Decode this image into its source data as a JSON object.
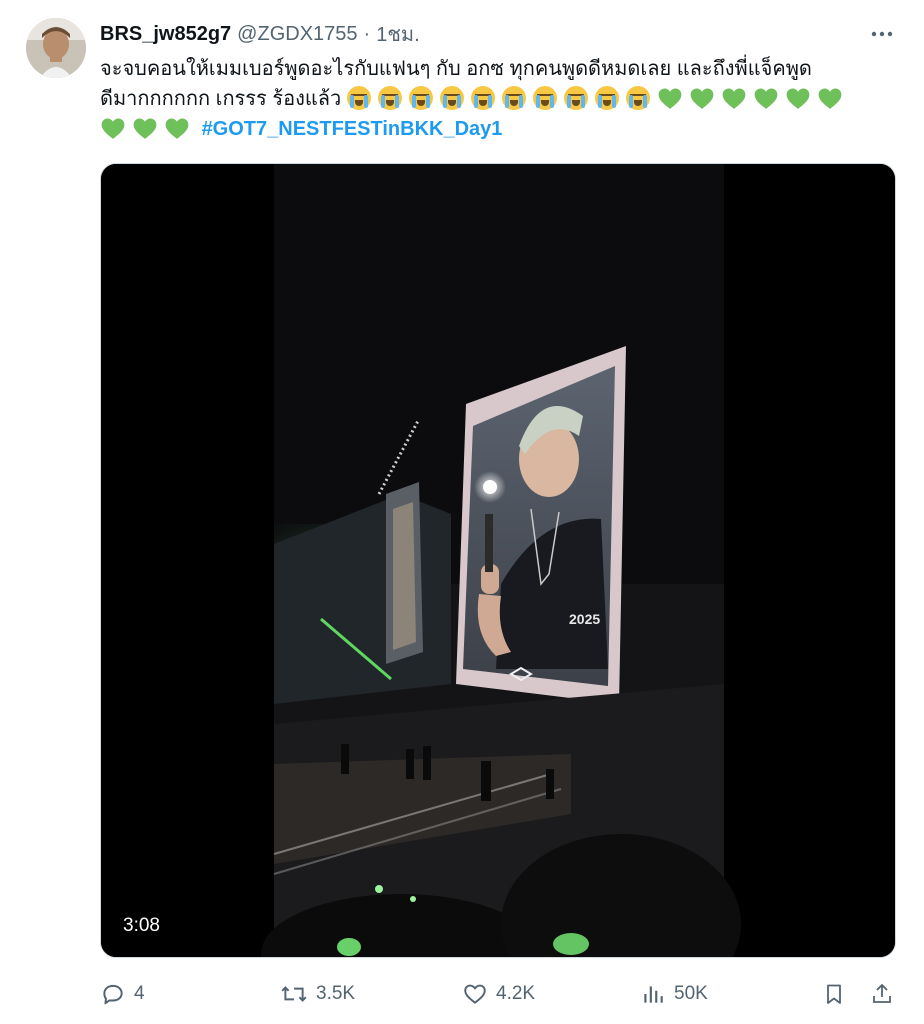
{
  "tweet": {
    "display_name": "BRS_jw852g7",
    "handle": "@ZGDX1755",
    "separator": "·",
    "time": "1ชม.",
    "text_line1": "จะจบคอนให้เมมเบอร์พูดอะไรกับแฟนๆ กับ อกซ ทุกคนพูดดีหมดเลย  และถึงพี่แจ็คพูด",
    "text_line2": "ดีมากกกกกก เกรรร ร้องแล้ว",
    "hashtag": "#GOT7_NESTFESTinBKK_Day1",
    "crying_emoji_count": 10,
    "green_heart_count": 9,
    "video_duration": "3:08",
    "screen_print": "2025"
  },
  "actions": {
    "replies": "4",
    "reposts": "3.5K",
    "likes": "4.2K",
    "views": "50K"
  },
  "icons": {
    "more": "more-horizontal-icon",
    "reply": "reply-bubble-icon",
    "repost": "repost-icon",
    "like": "heart-outline-icon",
    "views": "bar-chart-icon",
    "bookmark": "bookmark-icon",
    "share": "share-upload-icon"
  },
  "colors": {
    "hashtag": "#1d9bf0",
    "secondary_text": "#536471",
    "green_heart": "#6fbf5a"
  }
}
